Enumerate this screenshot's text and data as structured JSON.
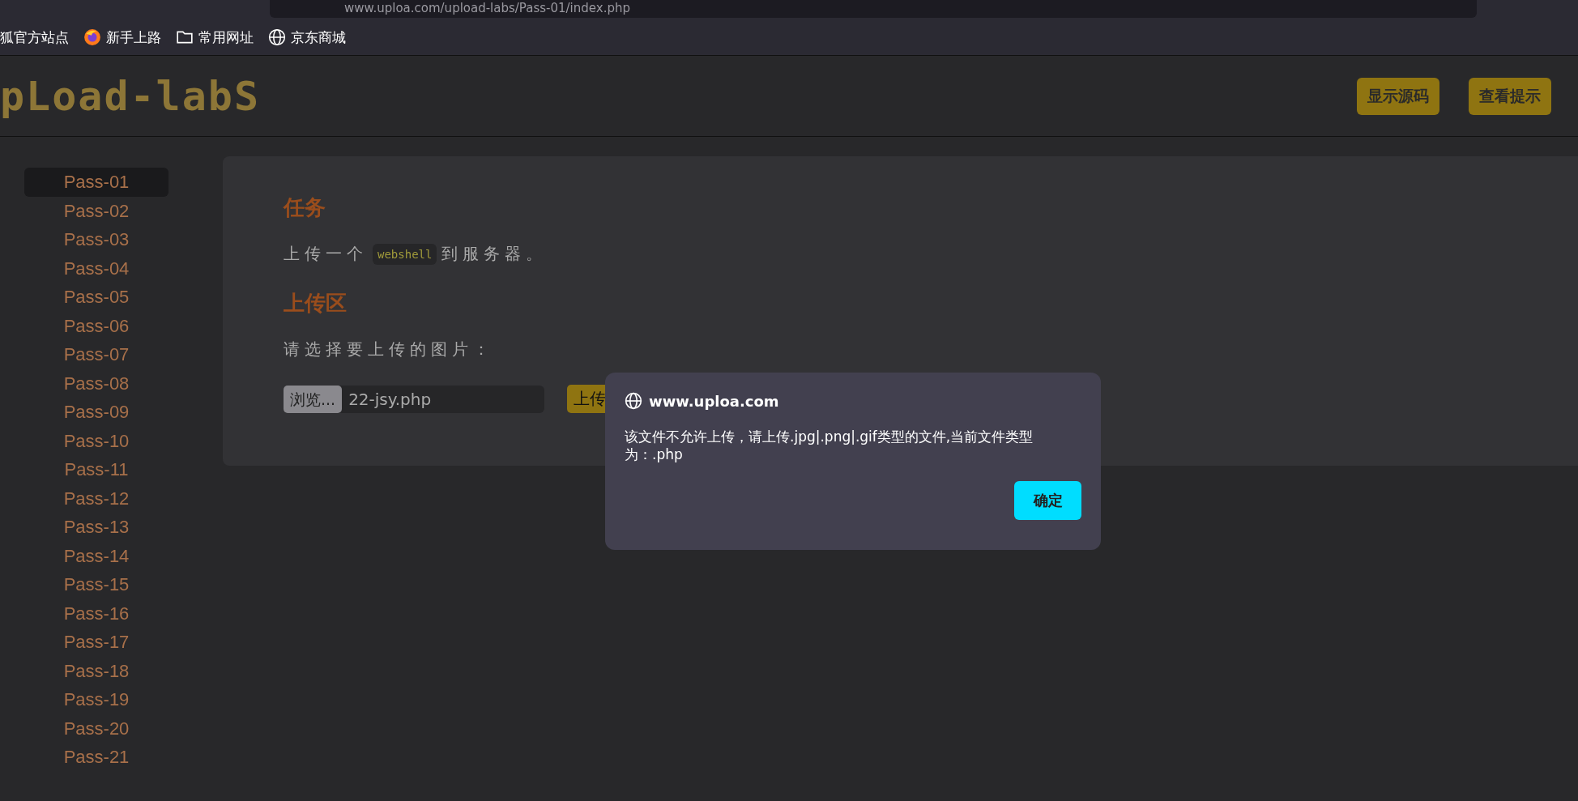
{
  "browser": {
    "url": "www.uploa.com/upload-labs/Pass-01/index.php",
    "bookmarks": [
      {
        "label": "狐官方站点",
        "kind": "none"
      },
      {
        "label": "新手上路",
        "kind": "firefox"
      },
      {
        "label": "常用网址",
        "kind": "folder"
      },
      {
        "label": "京东商城",
        "kind": "globe"
      }
    ]
  },
  "header": {
    "logo": "pLoad-labS",
    "buttons": [
      "显示源码",
      "查看提示"
    ]
  },
  "sidebar": {
    "items": [
      {
        "label": "Pass-01",
        "selected": true
      },
      {
        "label": "Pass-02",
        "selected": false
      },
      {
        "label": "Pass-03",
        "selected": false
      },
      {
        "label": "Pass-04",
        "selected": false
      },
      {
        "label": "Pass-05",
        "selected": false
      },
      {
        "label": "Pass-06",
        "selected": false
      },
      {
        "label": "Pass-07",
        "selected": false
      },
      {
        "label": "Pass-08",
        "selected": false
      },
      {
        "label": "Pass-09",
        "selected": false
      },
      {
        "label": "Pass-10",
        "selected": false
      },
      {
        "label": "Pass-11",
        "selected": false
      },
      {
        "label": "Pass-12",
        "selected": false
      },
      {
        "label": "Pass-13",
        "selected": false
      },
      {
        "label": "Pass-14",
        "selected": false
      },
      {
        "label": "Pass-15",
        "selected": false
      },
      {
        "label": "Pass-16",
        "selected": false
      },
      {
        "label": "Pass-17",
        "selected": false
      },
      {
        "label": "Pass-18",
        "selected": false
      },
      {
        "label": "Pass-19",
        "selected": false
      },
      {
        "label": "Pass-20",
        "selected": false
      },
      {
        "label": "Pass-21",
        "selected": false
      }
    ]
  },
  "task": {
    "heading": "任务",
    "before": "上传一个",
    "code": "webshell",
    "after": "到服务器。"
  },
  "upload": {
    "heading": "上传区",
    "prompt": "请选择要上传的图片：",
    "browse": "浏览...",
    "file": "22-jsy.php",
    "submit": "上传"
  },
  "dialog": {
    "origin": "www.uploa.com",
    "message": "该文件不允许上传，请上传.jpg|.png|.gif类型的文件,当前文件类型为：.php",
    "ok": "确定"
  }
}
